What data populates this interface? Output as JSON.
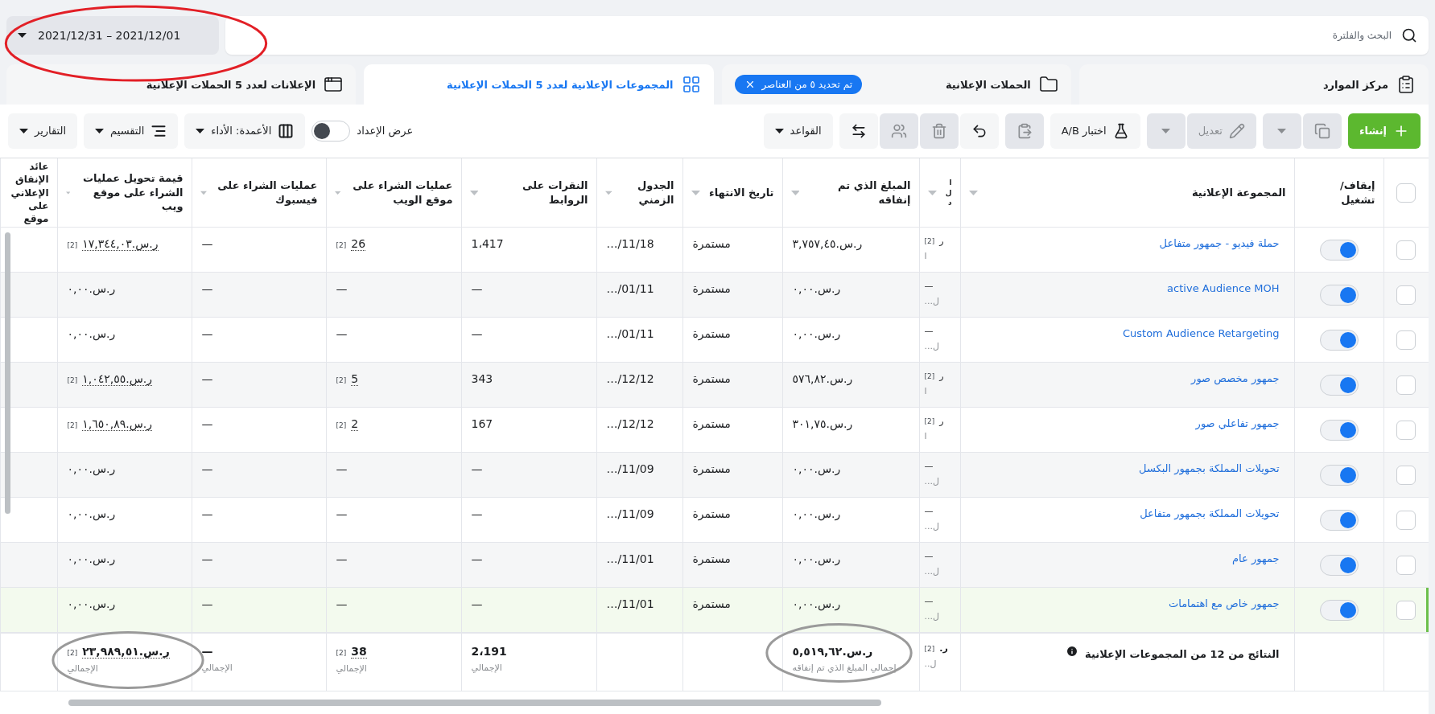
{
  "search": {
    "placeholder": "البحث والفلترة"
  },
  "date_range": {
    "label": "2021/12/31 – 2021/12/01",
    "circled": true
  },
  "tabs": [
    {
      "kind": "resources",
      "label": "مركز الموارد",
      "selected": false
    },
    {
      "kind": "campaigns",
      "label": "الحملات الإعلانية",
      "selected": false,
      "chip": "تم تحديد ٥ من العناصر"
    },
    {
      "kind": "adsets",
      "label": "المجموعات الإعلانية لعدد 5 الحملات الإعلانية",
      "selected": true
    },
    {
      "kind": "ads",
      "label": "الإعلانات لعدد 5 الحملات الإعلانية",
      "selected": false
    }
  ],
  "action_groups": [
    [
      {
        "kind": "create",
        "label": "إنشاء"
      }
    ],
    [
      {
        "kind": "duplicate",
        "disabled": true
      },
      {
        "kind": "dropdown",
        "disabled": true
      }
    ],
    [
      {
        "kind": "edit",
        "label": "تعديل",
        "disabled": true
      },
      {
        "kind": "dropdown",
        "disabled": true
      }
    ],
    [
      {
        "kind": "abtest",
        "label": "اختبار A/B",
        "disabled": false
      }
    ],
    [
      {
        "kind": "paste",
        "disabled": true
      }
    ],
    [
      {
        "kind": "undo",
        "disabled": false
      },
      {
        "kind": "delete",
        "disabled": true
      },
      {
        "kind": "people",
        "disabled": true
      },
      {
        "kind": "swap",
        "disabled": false
      }
    ],
    [
      {
        "kind": "rules",
        "label": "القواعد",
        "disabled": false
      }
    ]
  ],
  "view_controls": [
    {
      "kind": "toggle",
      "label": "عرض الإعداد",
      "on": false
    },
    {
      "kind": "columns",
      "label": "الأعمدة: الأداء"
    },
    {
      "kind": "breakdown",
      "label": "التقسيم"
    },
    {
      "kind": "reports",
      "label": "التقارير"
    }
  ],
  "header_checkbox": {
    "checked": false
  },
  "columns": [
    {
      "label": "إيقاف/ تشغيل"
    },
    {
      "label": "المجموعة الإعلانية"
    },
    {
      "label": "ا ل د"
    },
    {
      "label": "المبلغ الذي تم إنفاقه"
    },
    {
      "label": "تاريخ الانتهاء"
    },
    {
      "label": "الجدول الزمني"
    },
    {
      "label": "النقرات على الروابط"
    },
    {
      "label": "عمليات الشراء على موقع الويب"
    },
    {
      "label": "عمليات الشراء على فيسبوك"
    },
    {
      "label": "قيمة تحويل عمليات الشراء على موقع ويب"
    },
    {
      "label": "عائد الإنفاق الإعلاني على موقع"
    }
  ],
  "rows": [
    {
      "checked": false,
      "on": true,
      "highlighted": false,
      "name": "حملة فيديو - جمهور متفاعل",
      "column_4": {
        "text": "ر",
        "note": "[2]",
        "sub": "ا"
      },
      "spent": {
        "text": "ر.س.٣,٧٥٧,٤٥"
      },
      "end": {
        "text": "مستمرة"
      },
      "schedule": {
        "text": "…/11/18"
      },
      "clicks": {
        "text": "1،417"
      },
      "web": {
        "text": "26",
        "note": "[2]"
      },
      "fb": {
        "text": "—"
      },
      "value": {
        "text": "ر.س.١٧,٣٤٤,٠٣",
        "note": "[2]"
      }
    },
    {
      "checked": false,
      "on": true,
      "highlighted": false,
      "name": "active Audience MOH",
      "column_4": {
        "text": "—",
        "sub": "ل..."
      },
      "spent": {
        "text": "ر.س.٠,٠٠"
      },
      "end": {
        "text": "مستمرة"
      },
      "schedule": {
        "text": "…/01/11"
      },
      "clicks": {
        "text": "—"
      },
      "web": {
        "text": "—"
      },
      "fb": {
        "text": "—"
      },
      "value": {
        "text": "ر.س.٠,٠٠"
      }
    },
    {
      "checked": false,
      "on": true,
      "highlighted": false,
      "name": "Custom Audience Retargeting",
      "column_4": {
        "text": "—",
        "sub": "ل..."
      },
      "spent": {
        "text": "ر.س.٠,٠٠"
      },
      "end": {
        "text": "مستمرة"
      },
      "schedule": {
        "text": "…/01/11"
      },
      "clicks": {
        "text": "—"
      },
      "web": {
        "text": "—"
      },
      "fb": {
        "text": "—"
      },
      "value": {
        "text": "ر.س.٠,٠٠"
      }
    },
    {
      "checked": false,
      "on": true,
      "highlighted": false,
      "name": "جمهور مخصص صور",
      "column_4": {
        "text": "ر",
        "note": "[2]",
        "sub": "ا"
      },
      "spent": {
        "text": "ر.س.٥٧٦,٨٢"
      },
      "end": {
        "text": "مستمرة"
      },
      "schedule": {
        "text": "…/12/12"
      },
      "clicks": {
        "text": "343"
      },
      "web": {
        "text": "5",
        "note": "[2]"
      },
      "fb": {
        "text": "—"
      },
      "value": {
        "text": "ر.س.١,٠٤٢,٥٥",
        "note": "[2]"
      }
    },
    {
      "checked": false,
      "on": true,
      "highlighted": false,
      "name": "جمهور تفاعلي صور",
      "column_4": {
        "text": "ر",
        "note": "[2]",
        "sub": "ا"
      },
      "spent": {
        "text": "ر.س.٣٠١,٧٥"
      },
      "end": {
        "text": "مستمرة"
      },
      "schedule": {
        "text": "…/12/12"
      },
      "clicks": {
        "text": "167"
      },
      "web": {
        "text": "2",
        "note": "[2]"
      },
      "fb": {
        "text": "—"
      },
      "value": {
        "text": "ر.س.١,٦٥٠,٨٩",
        "note": "[2]"
      }
    },
    {
      "checked": false,
      "on": true,
      "highlighted": false,
      "name": "تحويلات المملكة بجمهور البكسل",
      "column_4": {
        "text": "—",
        "sub": "ل..."
      },
      "spent": {
        "text": "ر.س.٠,٠٠"
      },
      "end": {
        "text": "مستمرة"
      },
      "schedule": {
        "text": "…/11/09"
      },
      "clicks": {
        "text": "—"
      },
      "web": {
        "text": "—"
      },
      "fb": {
        "text": "—"
      },
      "value": {
        "text": "ر.س.٠,٠٠"
      }
    },
    {
      "checked": false,
      "on": true,
      "highlighted": false,
      "name": "تحويلات المملكة بجمهور متفاعل",
      "column_4": {
        "text": "—",
        "sub": "ل..."
      },
      "spent": {
        "text": "ر.س.٠,٠٠"
      },
      "end": {
        "text": "مستمرة"
      },
      "schedule": {
        "text": "…/11/09"
      },
      "clicks": {
        "text": "—"
      },
      "web": {
        "text": "—"
      },
      "fb": {
        "text": "—"
      },
      "value": {
        "text": "ر.س.٠,٠٠"
      }
    },
    {
      "checked": false,
      "on": true,
      "highlighted": false,
      "name": "جمهور عام",
      "column_4": {
        "text": "—",
        "sub": "ل..."
      },
      "spent": {
        "text": "ر.س.٠,٠٠"
      },
      "end": {
        "text": "مستمرة"
      },
      "schedule": {
        "text": "…/11/01"
      },
      "clicks": {
        "text": "—"
      },
      "web": {
        "text": "—"
      },
      "fb": {
        "text": "—"
      },
      "value": {
        "text": "ر.س.٠,٠٠"
      }
    },
    {
      "checked": false,
      "on": true,
      "highlighted": true,
      "name": "جمهور خاص مع اهتمامات",
      "column_4": {
        "text": "—",
        "sub": "ل..."
      },
      "spent": {
        "text": "ر.س.٠,٠٠"
      },
      "end": {
        "text": "مستمرة"
      },
      "schedule": {
        "text": "…/11/01"
      },
      "clicks": {
        "text": "—"
      },
      "web": {
        "text": "—"
      },
      "fb": {
        "text": "—"
      },
      "value": {
        "text": "ر.س.٠,٠٠"
      }
    }
  ],
  "totals": {
    "name": "النتائج من 12 من المجموعات الإعلانية",
    "column_4": {
      "text": "ر.",
      "note": "[2]",
      "sub": "ل.."
    },
    "spent": {
      "text": "ر.س.٥,٥١٩,٦٢",
      "sub": "إجمالي المبلغ الذي تم إنفاقه",
      "circled": true
    },
    "clicks": {
      "text": "2،191",
      "sub": "الإجمالي"
    },
    "web": {
      "text": "38",
      "note": "[2]",
      "sub": "الإجمالي"
    },
    "fb": {
      "text": "—",
      "sub": "الإجمالي"
    },
    "value": {
      "text": "ر.س.٢٣,٩٨٩,٥١",
      "note": "[2]",
      "sub": "الإجمالي",
      "circled": true
    }
  }
}
